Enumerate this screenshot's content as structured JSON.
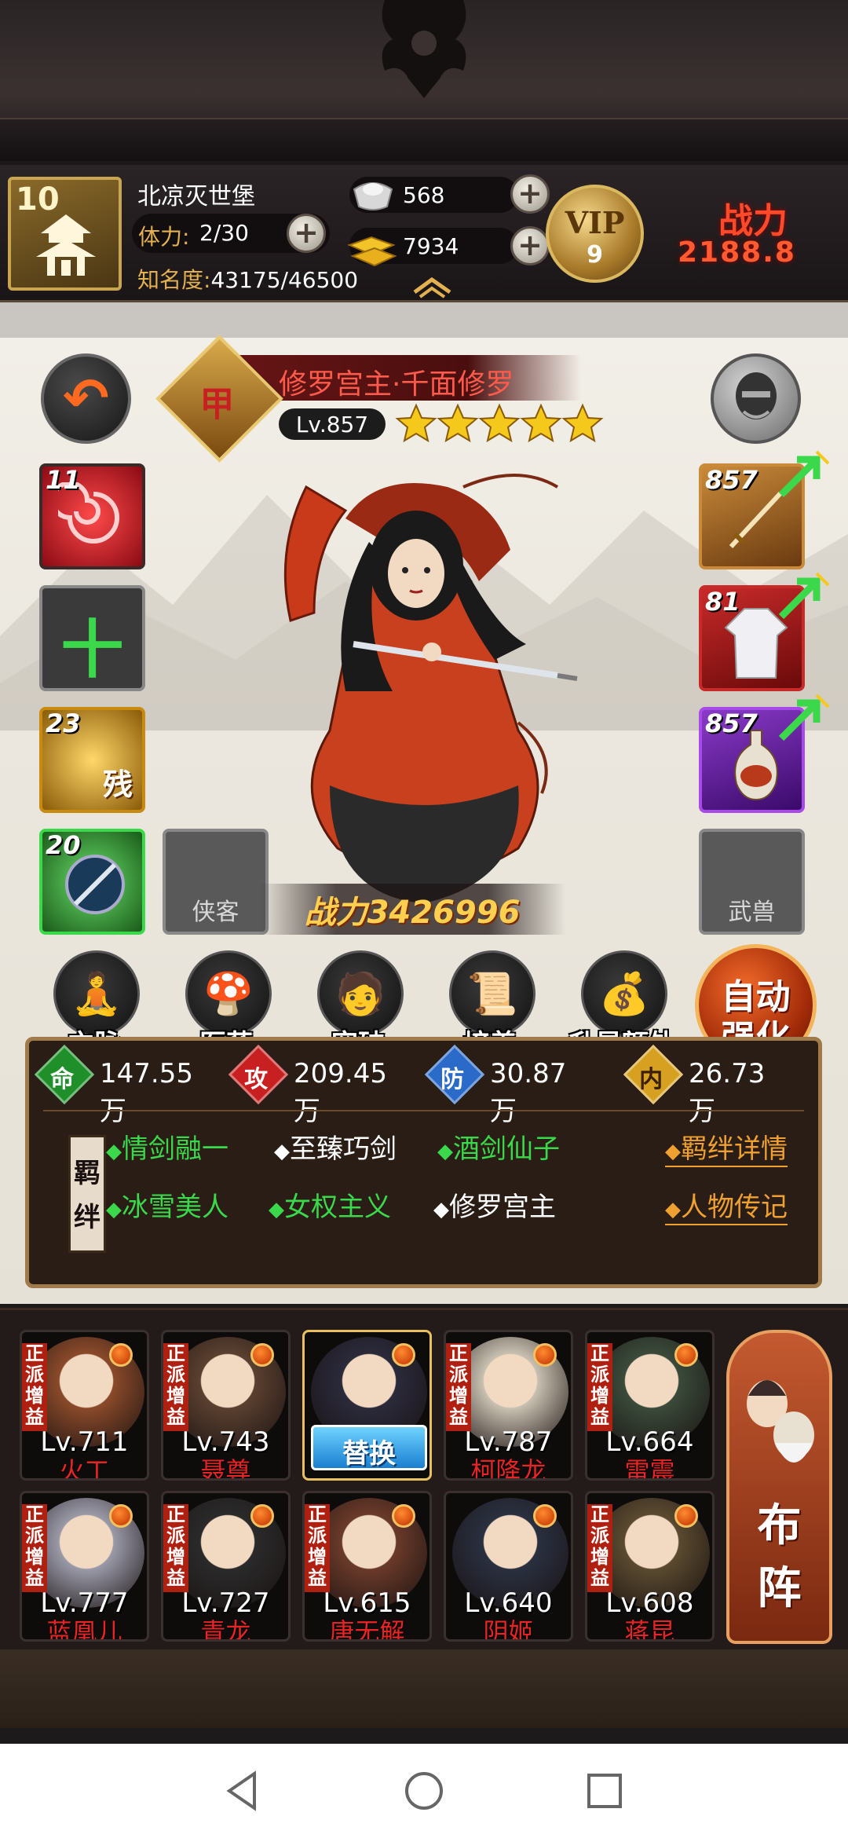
{
  "player": {
    "level": "10",
    "name": "北凉灭世堡",
    "stamina_label": "体力:",
    "stamina_value": "2/30",
    "fame_label": "知名度:",
    "fame_value": "43175/46500",
    "silver": "568",
    "gold": "7934",
    "vip_label": "VIP",
    "vip_level": "9",
    "power_label": "战力",
    "power_value": "2188.8"
  },
  "hero": {
    "rank": "甲",
    "title": "修罗宫主·千面修罗",
    "level": "Lv.857",
    "stars": 5,
    "combat_power": "战力3426996"
  },
  "left_slots": [
    {
      "num": "11",
      "label": ""
    },
    {
      "num": "",
      "label": "十"
    },
    {
      "num": "23",
      "label": "残"
    },
    {
      "num": "20",
      "label": ""
    }
  ],
  "right_slots": [
    {
      "num": "857"
    },
    {
      "num": "81"
    },
    {
      "num": "857"
    }
  ],
  "empty_slots": {
    "companion": "侠客",
    "beast": "武兽"
  },
  "functions": [
    "穴脉",
    "医药",
    "突破",
    "培养",
    "升星额外"
  ],
  "auto_strengthen": {
    "line1": "自动",
    "line2": "强化"
  },
  "stats": [
    {
      "icon": "命",
      "value": "147.55万",
      "color": "#1f8f2a"
    },
    {
      "icon": "攻",
      "value": "209.45万",
      "color": "#c82020"
    },
    {
      "icon": "防",
      "value": "30.87万",
      "color": "#2a6ac8"
    },
    {
      "icon": "内",
      "value": "26.73万",
      "color": "#d8a020"
    }
  ],
  "bond_label": "羁绊",
  "bond_tags": [
    {
      "text": "情剑融一",
      "active": true
    },
    {
      "text": "至臻巧剑",
      "active": false
    },
    {
      "text": "酒剑仙子",
      "active": true
    },
    {
      "text": "冰雪美人",
      "active": true
    },
    {
      "text": "女权主义",
      "active": true
    },
    {
      "text": "修罗宫主",
      "active": false
    }
  ],
  "links": {
    "bond_detail": "羁绊详情",
    "biography": "人物传记"
  },
  "roster": [
    {
      "level": "Lv.711",
      "name": "火工",
      "badge": "正派增益"
    },
    {
      "level": "Lv.743",
      "name": "聂尊",
      "badge": "正派增益"
    },
    {
      "level": "",
      "name": "",
      "badge": "",
      "selected": true
    },
    {
      "level": "Lv.787",
      "name": "柯降龙",
      "badge": "正派增益"
    },
    {
      "level": "Lv.664",
      "name": "雷震",
      "badge": "正派增益"
    },
    {
      "level": "Lv.777",
      "name": "蓝凰儿",
      "badge": "正派增益"
    },
    {
      "level": "Lv.727",
      "name": "青龙",
      "badge": "正派增益"
    },
    {
      "level": "Lv.615",
      "name": "唐无解",
      "badge": "正派增益"
    },
    {
      "level": "Lv.640",
      "name": "阴姬",
      "badge": ""
    },
    {
      "level": "Lv.608",
      "name": "蒋昆",
      "badge": "正派增益"
    }
  ],
  "swap_label": "替换",
  "formation": {
    "line1": "布",
    "line2": "阵"
  },
  "colors": {
    "accent_gold": "#e3b150",
    "power_red": "#ff4a2a",
    "name_red": "#e82424",
    "bond_green": "#3ad84a"
  }
}
